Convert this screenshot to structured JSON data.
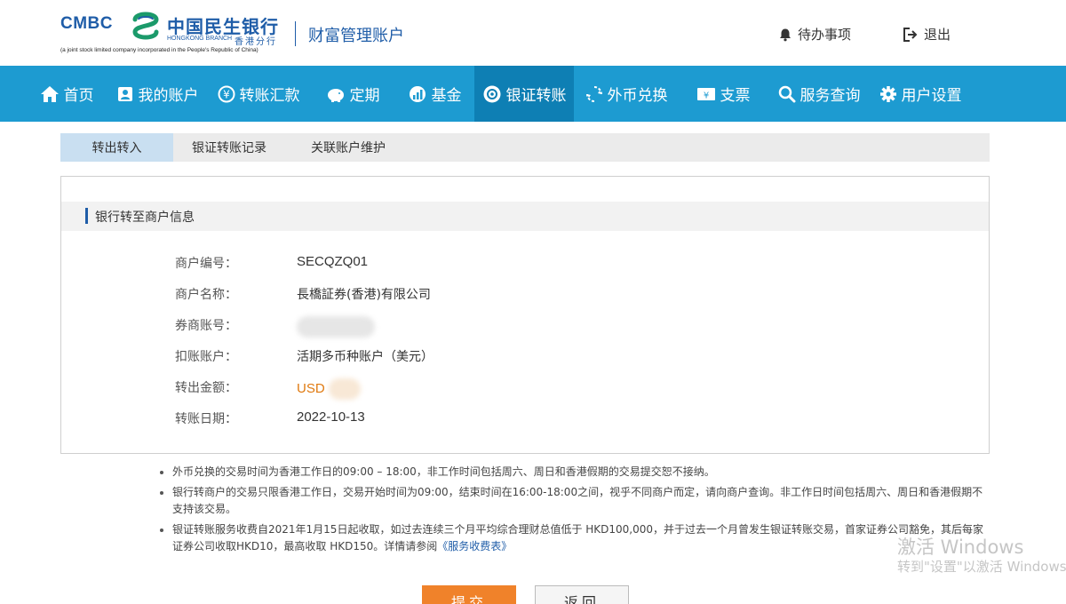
{
  "header": {
    "logo_en": "CMBC",
    "logo_cn": "中国民生银行",
    "logo_branch_en": "HONGKONG BRANCH",
    "logo_branch_cn": "香港分行",
    "logo_tagline": "(a joint stock limited company incorporated in the People's Republic of China)",
    "subtitle": "财富管理账户",
    "todo_label": "待办事项",
    "logout_label": "退出"
  },
  "nav": {
    "items": [
      {
        "label": "首页",
        "icon": "home-icon"
      },
      {
        "label": "我的账户",
        "icon": "account-icon"
      },
      {
        "label": "转账汇款",
        "icon": "transfer-icon"
      },
      {
        "label": "定期",
        "icon": "piggy-bank-icon"
      },
      {
        "label": "基金",
        "icon": "fund-chart-icon"
      },
      {
        "label": "银证转账",
        "icon": "bank-securities-icon",
        "active": true
      },
      {
        "label": "外币兑换",
        "icon": "exchange-icon"
      },
      {
        "label": "支票",
        "icon": "cheque-icon"
      },
      {
        "label": "服务查询",
        "icon": "search-icon"
      },
      {
        "label": "用户设置",
        "icon": "gear-icon"
      }
    ]
  },
  "subtabs": [
    {
      "label": "转出转入",
      "active": true
    },
    {
      "label": "银证转账记录"
    },
    {
      "label": "关联账户维护"
    }
  ],
  "panel": {
    "title": "银行转至商户信息",
    "rows": [
      {
        "label": "商户编号：",
        "value": "SECQZQ01"
      },
      {
        "label": "商户名称：",
        "value": "長橋証券(香港)有限公司"
      },
      {
        "label": "券商账号：",
        "value": ""
      },
      {
        "label": "扣账账户：",
        "value": "活期多币种账户（美元）"
      },
      {
        "label": "转出金额：",
        "value": "USD"
      },
      {
        "label": "转账日期：",
        "value": "2022-10-13"
      }
    ]
  },
  "notes": [
    {
      "text": "外币兑换的交易时间为香港工作日的09:00 – 18:00，非工作时间包括周六、周日和香港假期的交易提交恕不接纳。"
    },
    {
      "text": "银行转商户的交易只限香港工作日，交易开始时间为09:00，结束时间在16:00-18:00之间，视乎不同商户而定，请向商户查询。非工作日时间包括周六、周日和香港假期不支持该交易。"
    },
    {
      "text": "银证转账服务收费自2021年1月15日起收取，如过去连续三个月平均综合理财总值低于 HKD100,000，并于过去一个月曾发生银证转账交易，首家证券公司豁免，其后每家证券公司收取HKD10，最高收取 HKD150。详情请参阅",
      "link": "《服务收费表》"
    }
  ],
  "buttons": {
    "submit": "提交",
    "back": "返回"
  },
  "watermark": {
    "line1": "激活 Windows",
    "line2": "转到\"设置\"以激活 Windows。"
  },
  "colors": {
    "nav_bg": "#1d9bd1",
    "nav_active_bg": "#0e7fb4",
    "brand_blue": "#1f5da8",
    "submit_orange": "#f0822a",
    "amount_orange": "#e07a10"
  }
}
